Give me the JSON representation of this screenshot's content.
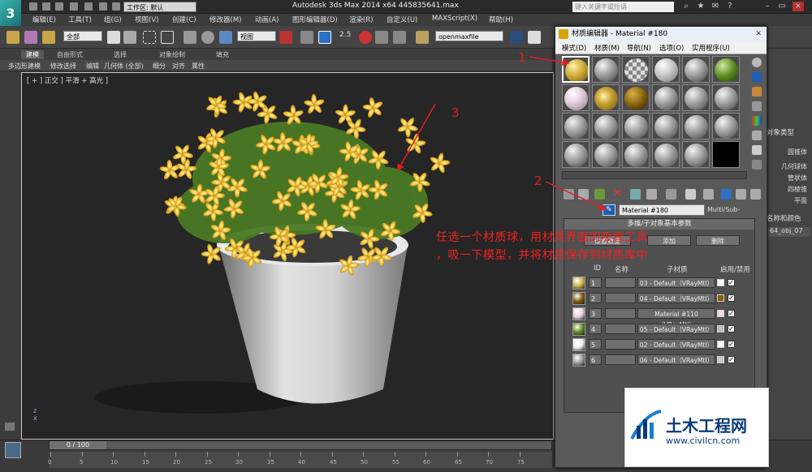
{
  "app": {
    "logo_text": "3",
    "workspace": "工作区: 默认",
    "title": "Autodesk 3ds Max  2014 x64      445835641.max",
    "help_search_placeholder": "键入关键字或短语"
  },
  "menu": [
    "编辑(E)",
    "工具(T)",
    "组(G)",
    "视图(V)",
    "创建(C)",
    "修改器(M)",
    "动画(A)",
    "图形编辑器(D)",
    "渲染(R)",
    "自定义(U)",
    "MAXScript(X)",
    "帮助(H)"
  ],
  "toolbar": {
    "selection_filter": "全部",
    "reference_coord": "视图",
    "named_selection": "openmaxfile",
    "snap_label": "2.5",
    "angle_snap": "A"
  },
  "ribbon": {
    "tabs": [
      "建模",
      "自由形式",
      "选择",
      "对象绘制",
      "填充"
    ],
    "subtabs": [
      "多边形建模",
      "修改选择",
      "编辑",
      "几何体 (全部)",
      "细分",
      "对齐",
      "属性"
    ]
  },
  "viewport": {
    "label": "[ + ] 正交 ] 平滑 + 高光 ]"
  },
  "timeline": {
    "position": "0 / 100",
    "ticks": [
      "0",
      "5",
      "10",
      "15",
      "20",
      "25",
      "30",
      "35",
      "40",
      "45",
      "50",
      "55",
      "60",
      "65",
      "70",
      "75"
    ]
  },
  "right_panel": {
    "header": "对象类型",
    "items": [
      "圆锥体",
      "几何球体",
      "管状体",
      "四棱锥",
      "平面"
    ],
    "color_header": "名称和颜色",
    "object_name": "64_obj_07"
  },
  "material_editor": {
    "title": "材质编辑器 - Material #180",
    "menu": [
      "模式(D)",
      "材质(M)",
      "导航(N)",
      "选项(O)",
      "实用程序(U)"
    ],
    "material_name": "Material #180",
    "material_type": "Multi/Sub-Object",
    "rollout_title": "多维/子对象基本参数",
    "buttons": {
      "set_count": "设置数量",
      "add": "添加",
      "delete": "删除"
    },
    "column_headers": {
      "id": "ID",
      "name": "名称",
      "submaterial": "子材质",
      "enable": "启用/禁用"
    },
    "submaterials": [
      {
        "id": "1",
        "material": "03 - Default（VRayMtl）",
        "swatch": "#c9b24c",
        "color": "#ffffff",
        "enabled": true
      },
      {
        "id": "2",
        "material": "04 - Default（VRayMtl）",
        "swatch": "#7a5a0a",
        "color": "#8a6000",
        "enabled": true
      },
      {
        "id": "3",
        "material": "Material #110（VRayMtl）",
        "swatch": "#e6d0e0",
        "color": "#f3d8ec",
        "enabled": true
      },
      {
        "id": "4",
        "material": "05 - Default（VRayMtl）",
        "swatch": "#5a8a20",
        "color": "#bdbdbd",
        "enabled": true
      },
      {
        "id": "5",
        "material": "02 - Default（VRayMtl）",
        "swatch": "#f0f0f0",
        "color": "#ffffff",
        "enabled": true
      },
      {
        "id": "6",
        "material": "06 - Default（VRayMtl）",
        "swatch": "#9a9a9a",
        "color": "#c8c8c8",
        "enabled": true
      }
    ]
  },
  "annotations": {
    "marker_1": "1",
    "marker_2": "2",
    "marker_3": "3",
    "instruction_line1": "任选一个材质球，用材质界面的吸管工具",
    "instruction_line2": "，吸一下模型，并将材质保存到材质库中"
  },
  "watermark": {
    "title": "土木工程网",
    "url": "www.civilcn.com"
  },
  "colors": {
    "annotation_red": "#e02020",
    "picker_blue": "#1d5fb3",
    "flower_yellow": "#f2c744"
  }
}
